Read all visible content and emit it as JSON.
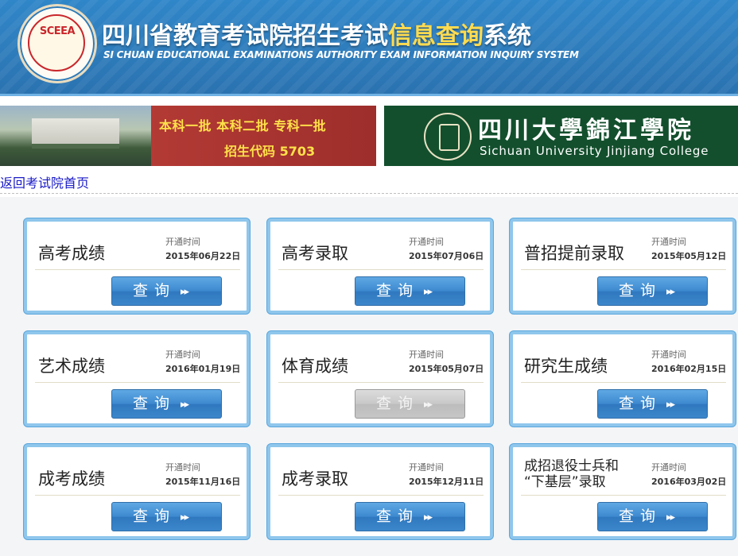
{
  "header": {
    "logo_text": "SCEEA",
    "title_part1": "四川省教育考试院招生考试",
    "title_part2": "信息查询",
    "title_part3": "系统",
    "subtitle": "SI CHUAN EDUCATIONAL EXAMINATIONS AUTHORITY EXAM INFORMATION INQUIRY SYSTEM"
  },
  "banner_left": {
    "line1": "本科一批  本科二批  专科一批",
    "line2": "招生代码 5703"
  },
  "banner_right": {
    "name_cn": "四川大學錦江學院",
    "name_en": "Sichuan University Jinjiang College"
  },
  "back_link": "返回考试院首页",
  "open_label": "开通时间",
  "query_label": "查询",
  "query_arrow": "▸▸",
  "cards": [
    {
      "name": "高考成绩",
      "date": "2015年06月22日",
      "enabled": true
    },
    {
      "name": "高考录取",
      "date": "2015年07月06日",
      "enabled": true
    },
    {
      "name": "普招提前录取",
      "date": "2015年05月12日",
      "enabled": true
    },
    {
      "name": "艺术成绩",
      "date": "2016年01月19日",
      "enabled": true
    },
    {
      "name": "体育成绩",
      "date": "2015年05月07日",
      "enabled": false
    },
    {
      "name": "研究生成绩",
      "date": "2016年02月15日",
      "enabled": true
    },
    {
      "name": "成考成绩",
      "date": "2015年11月16日",
      "enabled": true
    },
    {
      "name": "成考录取",
      "date": "2015年12月11日",
      "enabled": true
    },
    {
      "name_line1": "成招退役士兵和",
      "name_line2": "“下基层”录取",
      "date": "2016年03月02日",
      "enabled": true
    }
  ]
}
